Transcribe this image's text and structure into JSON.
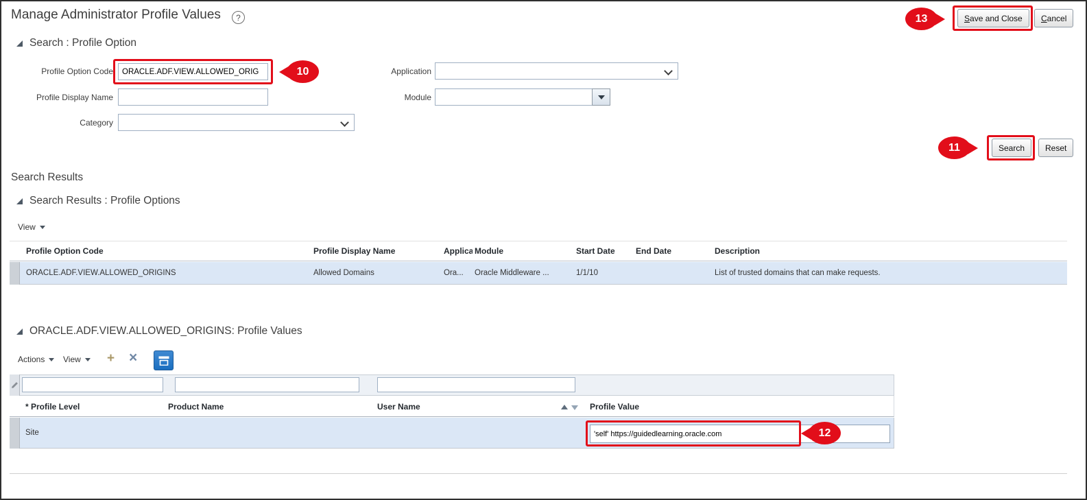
{
  "page": {
    "title": "Manage Administrator Profile Values"
  },
  "icons": {
    "help": "?",
    "add": "+",
    "delete": "×"
  },
  "colors": {
    "callout_red": "#e20e1a",
    "selected_row_blue": "#dbe7f6",
    "toolbar_icon_blue": "#1b6fc0"
  },
  "callouts": {
    "step10": "10",
    "step11": "11",
    "step12": "12",
    "step13": "13"
  },
  "toolbar_top": {
    "save_and_close": "Save and Close",
    "cancel": "Cancel"
  },
  "search": {
    "section_title": "Search : Profile Option",
    "labels": {
      "profile_option_code": "Profile Option Code",
      "profile_display_name": "Profile Display Name",
      "category": "Category",
      "application": "Application",
      "module": "Module"
    },
    "values": {
      "profile_option_code": "ORACLE.ADF.VIEW.ALLOWED_ORIG",
      "profile_display_name": "",
      "category": "",
      "application": "",
      "module": ""
    },
    "buttons": {
      "search": "Search",
      "reset": "Reset"
    }
  },
  "results": {
    "heading": "Search Results",
    "section_title": "Search Results : Profile Options",
    "view_menu": "View",
    "columns": {
      "profile_option_code": "Profile Option Code",
      "profile_display_name": "Profile Display Name",
      "application": "Applica",
      "module": "Module",
      "start_date": "Start Date",
      "end_date": "End Date",
      "description": "Description"
    },
    "rows": [
      {
        "profile_option_code": "ORACLE.ADF.VIEW.ALLOWED_ORIGINS",
        "profile_display_name": "Allowed Domains",
        "application": "Ora...",
        "module": "Oracle Middleware ...",
        "start_date": "1/1/10",
        "end_date": "",
        "description": "List of trusted domains that can make requests."
      }
    ]
  },
  "profile_values": {
    "section_title": "ORACLE.ADF.VIEW.ALLOWED_ORIGINS: Profile Values",
    "actions_menu": "Actions",
    "view_menu": "View",
    "columns": {
      "profile_level": "* Profile Level",
      "product_name": "Product Name",
      "user_name": "User Name",
      "profile_value": "Profile Value"
    },
    "filters": {
      "profile_level": "",
      "product_name": "",
      "user_name": ""
    },
    "rows": [
      {
        "profile_level": "Site",
        "product_name": "",
        "user_name": "",
        "profile_value": "'self' https://guidedlearning.oracle.com"
      }
    ]
  }
}
